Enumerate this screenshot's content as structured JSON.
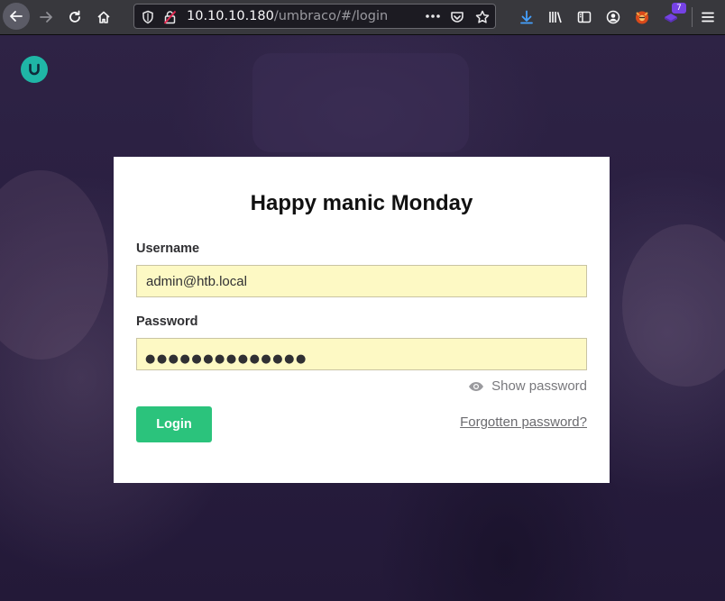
{
  "browser": {
    "url_host": "10.10.10.180",
    "url_path": "/umbraco/#/login",
    "extensions_badge": "7",
    "icons": [
      "back-arrow-icon",
      "forward-arrow-icon",
      "reload-icon",
      "home-icon",
      "shield-icon",
      "insecure-lock-icon",
      "more-icon",
      "pocket-icon",
      "bookmark-star-icon",
      "download-icon",
      "library-icon",
      "sidebar-icon",
      "account-icon",
      "foxyproxy-icon",
      "extension-icon",
      "menu-icon"
    ]
  },
  "colors": {
    "accent_green": "#2bc37c",
    "logo_teal": "#1fb6a6",
    "field_autofill": "#fdf9c4"
  },
  "login": {
    "title": "Happy manic Monday",
    "username_label": "Username",
    "username_value": "admin@htb.local",
    "password_label": "Password",
    "password_dots": "●●●●●●●●●●●●●●",
    "show_password": "Show password",
    "login_button": "Login",
    "forgotten_password": "Forgotten password?"
  }
}
